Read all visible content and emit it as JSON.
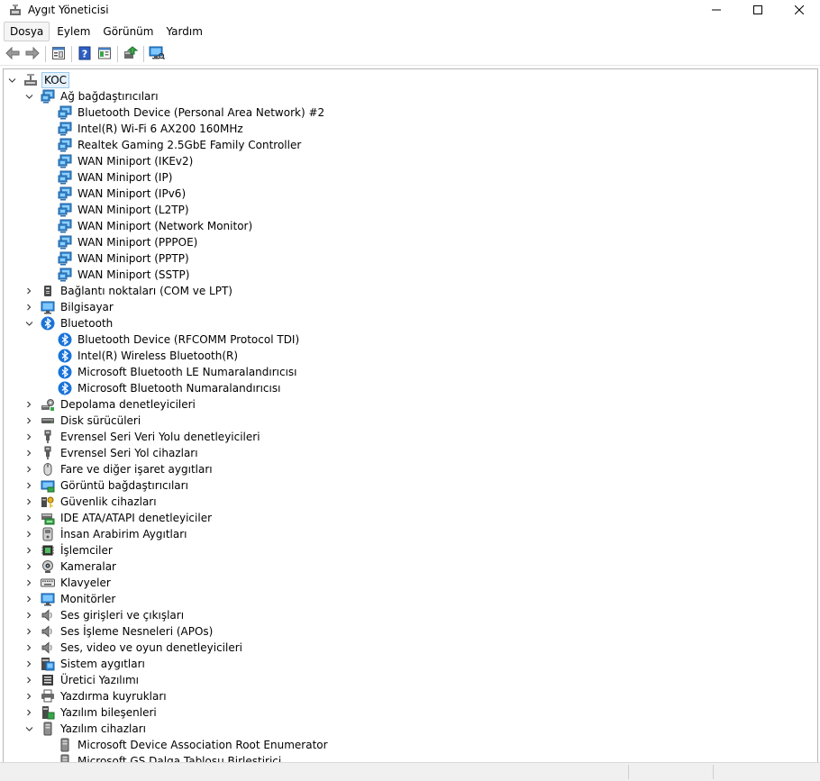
{
  "window": {
    "title": "Aygıt Yöneticisi",
    "icons": {
      "app": "device-manager-icon",
      "minimize": "minimize-icon",
      "maximize": "maximize-icon",
      "close": "close-icon"
    }
  },
  "menu": [
    {
      "label": "Dosya",
      "active": true
    },
    {
      "label": "Eylem"
    },
    {
      "label": "Görünüm"
    },
    {
      "label": "Yardım"
    }
  ],
  "toolbar": [
    {
      "icon": "back-arrow-icon"
    },
    {
      "icon": "forward-arrow-icon"
    },
    {
      "sep": true
    },
    {
      "icon": "properties-icon"
    },
    {
      "sep": true
    },
    {
      "icon": "help-icon"
    },
    {
      "icon": "driver-view-icon"
    },
    {
      "sep": true
    },
    {
      "icon": "update-driver-icon"
    },
    {
      "sep": true
    },
    {
      "icon": "scan-hardware-icon"
    }
  ],
  "tree": [
    {
      "label": "KOC",
      "level": 0,
      "expanded": true,
      "icon": "computer-icon",
      "selected": true
    },
    {
      "label": "Ağ bağdaştırıcıları",
      "level": 1,
      "expanded": true,
      "icon": "network-adapter-icon"
    },
    {
      "label": "Bluetooth Device (Personal Area Network) #2",
      "level": 2,
      "icon": "network-adapter-icon"
    },
    {
      "label": "Intel(R) Wi-Fi 6 AX200 160MHz",
      "level": 2,
      "icon": "network-adapter-icon"
    },
    {
      "label": "Realtek Gaming 2.5GbE Family Controller",
      "level": 2,
      "icon": "network-adapter-icon"
    },
    {
      "label": "WAN Miniport (IKEv2)",
      "level": 2,
      "icon": "network-adapter-icon"
    },
    {
      "label": "WAN Miniport (IP)",
      "level": 2,
      "icon": "network-adapter-icon"
    },
    {
      "label": "WAN Miniport (IPv6)",
      "level": 2,
      "icon": "network-adapter-icon"
    },
    {
      "label": "WAN Miniport (L2TP)",
      "level": 2,
      "icon": "network-adapter-icon"
    },
    {
      "label": "WAN Miniport (Network Monitor)",
      "level": 2,
      "icon": "network-adapter-icon"
    },
    {
      "label": "WAN Miniport (PPPOE)",
      "level": 2,
      "icon": "network-adapter-icon"
    },
    {
      "label": "WAN Miniport (PPTP)",
      "level": 2,
      "icon": "network-adapter-icon"
    },
    {
      "label": "WAN Miniport (SSTP)",
      "level": 2,
      "icon": "network-adapter-icon"
    },
    {
      "label": "Bağlantı noktaları (COM ve LPT)",
      "level": 1,
      "expanded": false,
      "icon": "port-icon"
    },
    {
      "label": "Bilgisayar",
      "level": 1,
      "expanded": false,
      "icon": "monitor-icon"
    },
    {
      "label": "Bluetooth",
      "level": 1,
      "expanded": true,
      "icon": "bluetooth-icon"
    },
    {
      "label": "Bluetooth Device (RFCOMM Protocol TDI)",
      "level": 2,
      "icon": "bluetooth-icon"
    },
    {
      "label": "Intel(R) Wireless Bluetooth(R)",
      "level": 2,
      "icon": "bluetooth-icon"
    },
    {
      "label": "Microsoft Bluetooth LE Numaralandırıcısı",
      "level": 2,
      "icon": "bluetooth-icon"
    },
    {
      "label": "Microsoft Bluetooth Numaralandırıcısı",
      "level": 2,
      "icon": "bluetooth-icon"
    },
    {
      "label": "Depolama denetleyicileri",
      "level": 1,
      "expanded": false,
      "icon": "storage-controller-icon"
    },
    {
      "label": "Disk sürücüleri",
      "level": 1,
      "expanded": false,
      "icon": "disk-drive-icon"
    },
    {
      "label": "Evrensel Seri Veri Yolu denetleyicileri",
      "level": 1,
      "expanded": false,
      "icon": "usb-icon"
    },
    {
      "label": "Evrensel Seri Yol cihazları",
      "level": 1,
      "expanded": false,
      "icon": "usb-icon"
    },
    {
      "label": "Fare ve diğer işaret aygıtları",
      "level": 1,
      "expanded": false,
      "icon": "mouse-icon"
    },
    {
      "label": "Görüntü bağdaştırıcıları",
      "level": 1,
      "expanded": false,
      "icon": "display-adapter-icon"
    },
    {
      "label": "Güvenlik cihazları",
      "level": 1,
      "expanded": false,
      "icon": "security-device-icon"
    },
    {
      "label": "IDE ATA/ATAPI denetleyiciler",
      "level": 1,
      "expanded": false,
      "icon": "ide-controller-icon"
    },
    {
      "label": "İnsan Arabirim Aygıtları",
      "level": 1,
      "expanded": false,
      "icon": "hid-icon"
    },
    {
      "label": "İşlemciler",
      "level": 1,
      "expanded": false,
      "icon": "processor-icon"
    },
    {
      "label": "Kameralar",
      "level": 1,
      "expanded": false,
      "icon": "camera-icon"
    },
    {
      "label": "Klavyeler",
      "level": 1,
      "expanded": false,
      "icon": "keyboard-icon"
    },
    {
      "label": "Monitörler",
      "level": 1,
      "expanded": false,
      "icon": "monitor-icon"
    },
    {
      "label": "Ses girişleri ve çıkışları",
      "level": 1,
      "expanded": false,
      "icon": "speaker-icon"
    },
    {
      "label": "Ses İşleme Nesneleri (APOs)",
      "level": 1,
      "expanded": false,
      "icon": "speaker-icon"
    },
    {
      "label": "Ses, video ve oyun denetleyicileri",
      "level": 1,
      "expanded": false,
      "icon": "speaker-icon"
    },
    {
      "label": "Sistem aygıtları",
      "level": 1,
      "expanded": false,
      "icon": "system-device-icon"
    },
    {
      "label": "Üretici Yazılımı",
      "level": 1,
      "expanded": false,
      "icon": "firmware-icon"
    },
    {
      "label": "Yazdırma kuyrukları",
      "level": 1,
      "expanded": false,
      "icon": "printer-icon"
    },
    {
      "label": "Yazılım bileşenleri",
      "level": 1,
      "expanded": false,
      "icon": "software-component-icon"
    },
    {
      "label": "Yazılım cihazları",
      "level": 1,
      "expanded": true,
      "icon": "software-device-icon"
    },
    {
      "label": "Microsoft Device Association Root Enumerator",
      "level": 2,
      "icon": "software-device-icon"
    },
    {
      "label": "Microsoft GS Dalga Tablosu Birleştirici",
      "level": 2,
      "icon": "software-device-icon"
    }
  ],
  "colors": {
    "selection_bg": "#e5f1fb",
    "selection_border": "#99c9ef",
    "accent": "#1a73d9"
  }
}
